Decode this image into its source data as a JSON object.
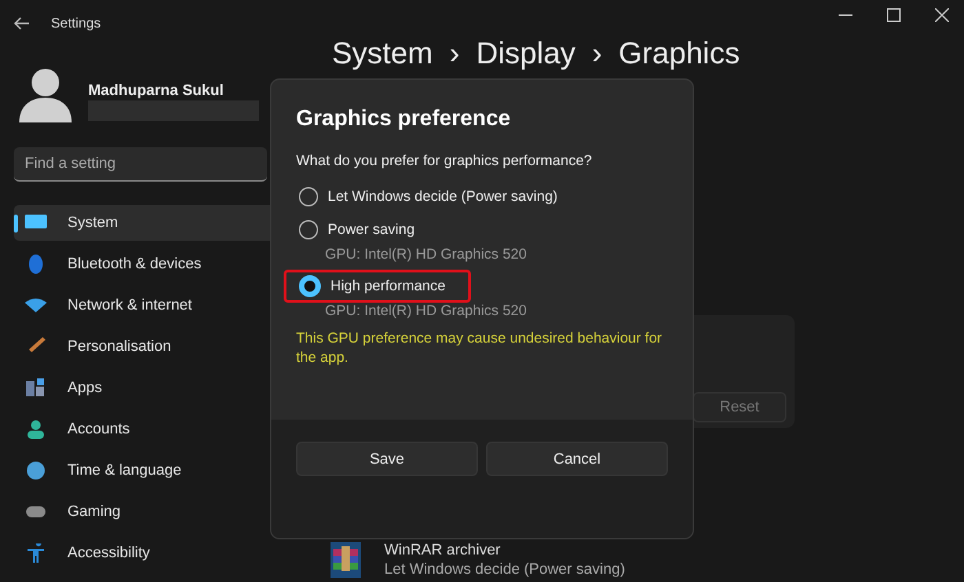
{
  "window": {
    "title": "Settings"
  },
  "user": {
    "name": "Madhuparna Sukul"
  },
  "search": {
    "placeholder": "Find a setting"
  },
  "nav": [
    {
      "label": "System",
      "selected": true
    },
    {
      "label": "Bluetooth & devices",
      "selected": false
    },
    {
      "label": "Network & internet",
      "selected": false
    },
    {
      "label": "Personalisation",
      "selected": false
    },
    {
      "label": "Apps",
      "selected": false
    },
    {
      "label": "Accounts",
      "selected": false
    },
    {
      "label": "Time & language",
      "selected": false
    },
    {
      "label": "Gaming",
      "selected": false
    },
    {
      "label": "Accessibility",
      "selected": false
    }
  ],
  "breadcrumb": {
    "items": [
      "System",
      "Display",
      "Graphics"
    ],
    "separator": "›"
  },
  "reset_button": "Reset",
  "apps": [
    {
      "name": "WinRAR archiver",
      "preference": "Let Windows decide (Power saving)"
    }
  ],
  "dialog": {
    "title": "Graphics preference",
    "question": "What do you prefer for graphics performance?",
    "options": [
      {
        "label": "Let Windows decide (Power saving)",
        "selected": false,
        "highlighted": false
      },
      {
        "label": "Power saving",
        "gpu": "GPU: Intel(R) HD Graphics 520",
        "selected": false,
        "highlighted": false
      },
      {
        "label": "High performance",
        "gpu": "GPU: Intel(R) HD Graphics 520",
        "selected": true,
        "highlighted": true
      }
    ],
    "warning": "This GPU preference may cause undesired behaviour for the app.",
    "buttons": [
      "Save",
      "Cancel"
    ]
  }
}
